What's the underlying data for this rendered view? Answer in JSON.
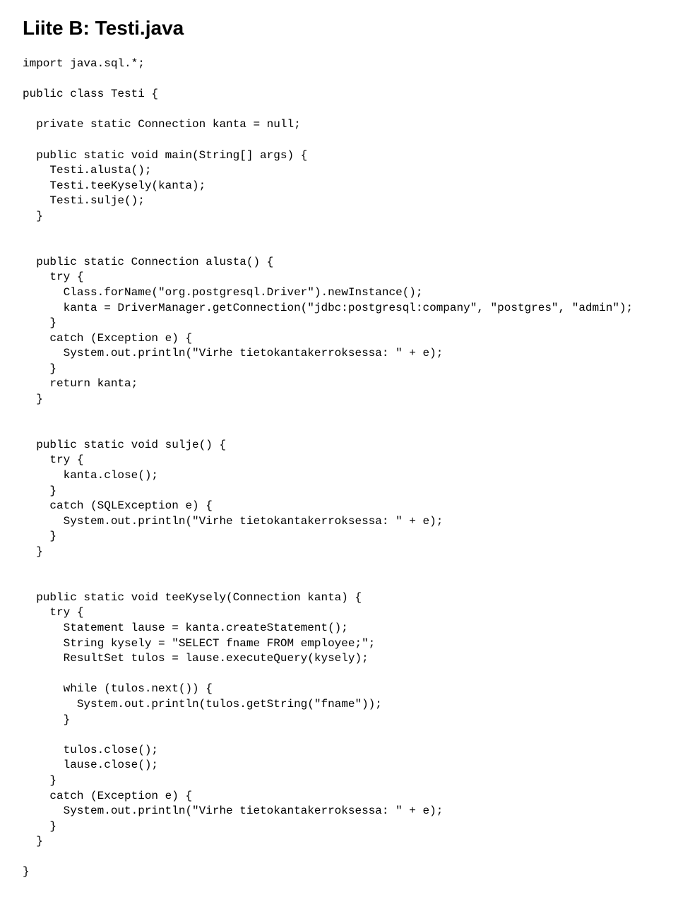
{
  "title": "Liite B: Testi.java",
  "code": "import java.sql.*;\n\npublic class Testi {\n\n  private static Connection kanta = null;\n\n  public static void main(String[] args) {\n    Testi.alusta();\n    Testi.teeKysely(kanta);\n    Testi.sulje();\n  }\n\n\n  public static Connection alusta() {\n    try {\n      Class.forName(\"org.postgresql.Driver\").newInstance();\n      kanta = DriverManager.getConnection(\"jdbc:postgresql:company\", \"postgres\", \"admin\");\n    }\n    catch (Exception e) {\n      System.out.println(\"Virhe tietokantakerroksessa: \" + e);\n    }\n    return kanta;\n  }\n\n\n  public static void sulje() {\n    try {\n      kanta.close();\n    }\n    catch (SQLException e) {\n      System.out.println(\"Virhe tietokantakerroksessa: \" + e);\n    }\n  }\n\n\n  public static void teeKysely(Connection kanta) {\n    try {\n      Statement lause = kanta.createStatement();\n      String kysely = \"SELECT fname FROM employee;\";\n      ResultSet tulos = lause.executeQuery(kysely);\n\n      while (tulos.next()) {\n        System.out.println(tulos.getString(\"fname\"));\n      }\n\n      tulos.close();\n      lause.close();\n    }\n    catch (Exception e) {\n      System.out.println(\"Virhe tietokantakerroksessa: \" + e);\n    }\n  }\n\n}"
}
